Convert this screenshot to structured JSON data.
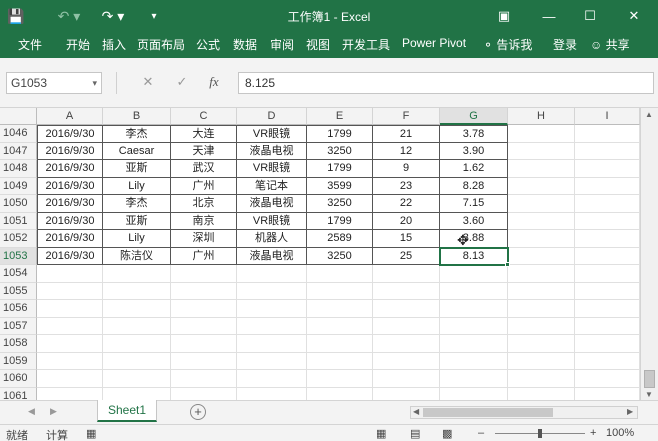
{
  "window": {
    "title": "工作簿1 - Excel"
  },
  "ribbon": {
    "tabs": [
      "文件",
      "开始",
      "插入",
      "页面布局",
      "公式",
      "数据",
      "审阅",
      "视图",
      "开发工具",
      "Power Pivot"
    ],
    "tell_me": "告诉我",
    "login": "登录",
    "share": "共享"
  },
  "formula_bar": {
    "name_box": "G1053",
    "fx": "fx",
    "value": "8.125"
  },
  "columns": [
    "A",
    "B",
    "C",
    "D",
    "E",
    "F",
    "G",
    "H",
    "I"
  ],
  "selected_column": "G",
  "rows": [
    "1046",
    "1047",
    "1048",
    "1049",
    "1050",
    "1051",
    "1052",
    "1053",
    "1054",
    "1055",
    "1056",
    "1057",
    "1058",
    "1059",
    "1060",
    "1061"
  ],
  "selected_row": "1053",
  "data_rows": [
    [
      "2016/9/30",
      "李杰",
      "大连",
      "VR眼镜",
      "1799",
      "21",
      "3.78"
    ],
    [
      "2016/9/30",
      "Caesar",
      "天津",
      "液晶电视",
      "3250",
      "12",
      "3.90"
    ],
    [
      "2016/9/30",
      "亚斯",
      "武汉",
      "VR眼镜",
      "1799",
      "9",
      "1.62"
    ],
    [
      "2016/9/30",
      "Lily",
      "广州",
      "笔记本",
      "3599",
      "23",
      "8.28"
    ],
    [
      "2016/9/30",
      "李杰",
      "北京",
      "液晶电视",
      "3250",
      "22",
      "7.15"
    ],
    [
      "2016/9/30",
      "亚斯",
      "南京",
      "VR眼镜",
      "1799",
      "20",
      "3.60"
    ],
    [
      "2016/9/30",
      "Lily",
      "深圳",
      "机器人",
      "2589",
      "15",
      "3.88"
    ],
    [
      "2016/9/30",
      "陈洁仪",
      "广州",
      "液晶电视",
      "3250",
      "25",
      "8.13"
    ]
  ],
  "sheet_tabs": [
    "Sheet1"
  ],
  "status": {
    "ready": "就绪",
    "calc": "计算",
    "zoom": "100%"
  },
  "colors": {
    "excel_green": "#217346"
  }
}
